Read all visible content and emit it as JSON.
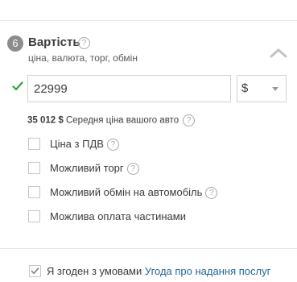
{
  "section": {
    "step": "6",
    "title": "Вартість",
    "help_glyph": "?",
    "subtitle": "ціна, валюта, торг, обмін"
  },
  "price": {
    "value": "22999",
    "placeholder": "",
    "valid": true
  },
  "currency": {
    "selected": "$"
  },
  "average": {
    "value": "35 012 $",
    "text": "Середня ціна вашого авто"
  },
  "options": [
    {
      "label": "Ціна з ПДВ",
      "checked": false,
      "has_help": true
    },
    {
      "label": "Можливий торг",
      "checked": false,
      "has_help": true
    },
    {
      "label": "Можливий обмін на автомобіль",
      "checked": false,
      "has_help": true
    },
    {
      "label": "Можлива оплата частинами",
      "checked": false,
      "has_help": false
    }
  ],
  "agreement": {
    "checked": true,
    "text": "Я згоден з умовами",
    "link": "Угода про надання послуг"
  },
  "colors": {
    "valid_check": "#2fa52f",
    "link": "#256799",
    "badge": "#8c8c8c"
  }
}
